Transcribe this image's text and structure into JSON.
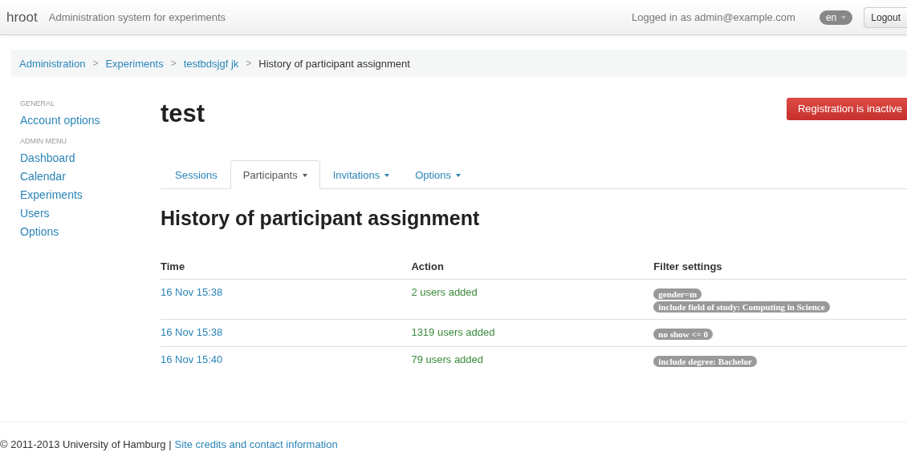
{
  "navbar": {
    "brand": "hroot",
    "tagline": "Administration system for experiments",
    "login_text": "Logged in as admin@example.com",
    "language": "en",
    "logout": "Logout"
  },
  "breadcrumb": {
    "separator": ">",
    "items": [
      {
        "label": "Administration",
        "link": true
      },
      {
        "label": "Experiments",
        "link": true
      },
      {
        "label": "testbdsjgf jk",
        "link": true
      },
      {
        "label": "History of participant assignment",
        "link": false
      }
    ]
  },
  "sidebar": {
    "sections": [
      {
        "header": "GENERAL",
        "items": [
          "Account options"
        ]
      },
      {
        "header": "ADMIN MENU",
        "items": [
          "Dashboard",
          "Calendar",
          "Experiments",
          "Users",
          "Options"
        ]
      }
    ]
  },
  "experiment_title": "test",
  "registration_button": "Registration is inactive",
  "tabs": [
    {
      "label": "Sessions",
      "selected": false,
      "dropdown": false
    },
    {
      "label": "Participants",
      "selected": true,
      "dropdown": true
    },
    {
      "label": "Invitations",
      "selected": false,
      "dropdown": true
    },
    {
      "label": "Options",
      "selected": false,
      "dropdown": true
    }
  ],
  "page_title": "History of participant assignment",
  "table": {
    "columns": [
      "Time",
      "Action",
      "Filter settings"
    ],
    "rows": [
      {
        "time": "16 Nov 15:38",
        "action": "2 users added",
        "filters": [
          "gender=m",
          "include field of study: Computing in Science"
        ]
      },
      {
        "time": "16 Nov 15:38",
        "action": "1319 users added",
        "filters": [
          "no show <= 0"
        ]
      },
      {
        "time": "16 Nov 15:40",
        "action": "79 users added",
        "filters": [
          "include degree: Bachelor"
        ]
      }
    ]
  },
  "footer": {
    "copyright": "© 2011-2013 University of Hamburg |",
    "link": "Site credits and contact information"
  }
}
